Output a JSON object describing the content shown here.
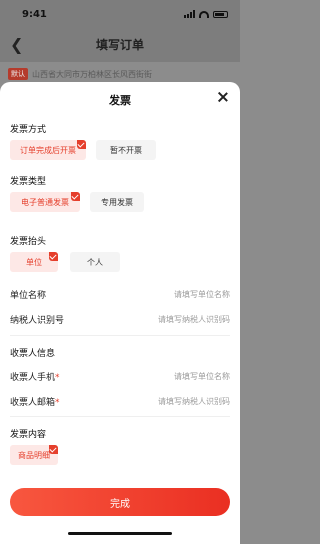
{
  "status_bar": {
    "time": "9:41"
  },
  "background": {
    "title": "填写订单",
    "back_icon": "chevron-left-icon",
    "address_tag": "默认",
    "address_text": "山西省大同市万柏林区长风西街街"
  },
  "sheet": {
    "title": "发票",
    "close_icon": "close-icon",
    "invoice_method": {
      "label": "发票方式",
      "options": [
        "订单完成后开票",
        "暂不开票"
      ],
      "selected": "订单完成后开票"
    },
    "invoice_type": {
      "label": "发票类型",
      "options": [
        "电子普通发票",
        "专用发票"
      ],
      "selected": "电子普通发票"
    },
    "invoice_header": {
      "label": "发票抬头",
      "options": [
        "单位",
        "个人"
      ],
      "selected": "单位"
    },
    "company_name": {
      "label": "单位名称",
      "placeholder": "请填写单位名称"
    },
    "tax_id": {
      "label": "纳税人识别号",
      "placeholder": "请填写纳税人识别码"
    },
    "recipient": {
      "label": "收票人信息",
      "phone": {
        "label": "收票人手机",
        "required_mark": "*",
        "placeholder": "请填写单位名称"
      },
      "email": {
        "label": "收票人邮箱",
        "required_mark": "*",
        "placeholder": "请填写纳税人识别码"
      }
    },
    "content": {
      "label": "发票内容",
      "options": [
        "商品明细"
      ],
      "selected": "商品明细"
    },
    "submit_label": "完成"
  },
  "colors": {
    "accent": "#e53f2c",
    "accent_light": "#fde8e6",
    "chip_off": "#f4f4f4"
  }
}
